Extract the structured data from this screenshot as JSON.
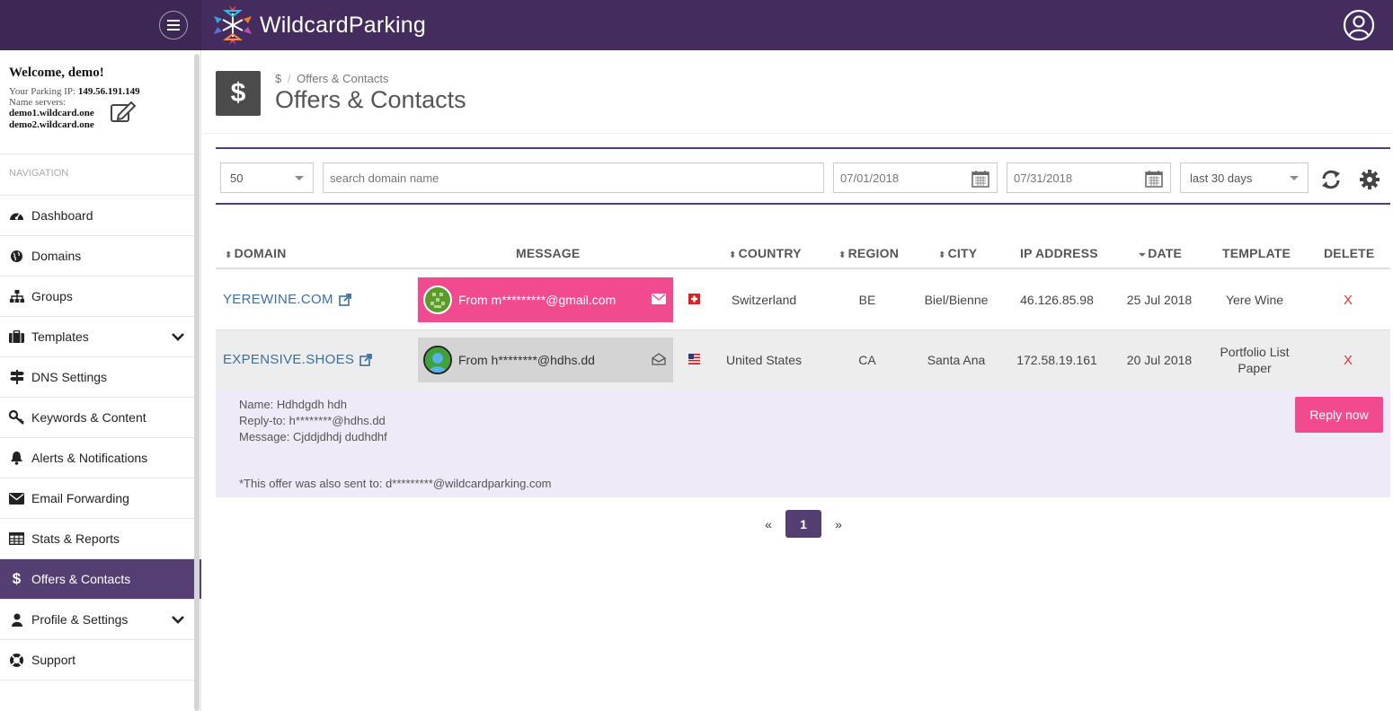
{
  "brand": {
    "name": "WildcardParking"
  },
  "sidebar": {
    "welcome": "Welcome, demo!",
    "parking_ip_label": "Your Parking IP:",
    "parking_ip": "149.56.191.149",
    "nameservers_label": "Name servers:",
    "ns1": "demo1.wildcard.one",
    "ns2": "demo2.wildcard.one",
    "nav_heading": "NAVIGATION",
    "items": [
      {
        "label": "Dashboard",
        "icon": "dashboard-icon"
      },
      {
        "label": "Domains",
        "icon": "globe-icon"
      },
      {
        "label": "Groups",
        "icon": "sitemap-icon"
      },
      {
        "label": "Templates",
        "icon": "briefcase-icon",
        "expandable": true
      },
      {
        "label": "DNS Settings",
        "icon": "signpost-icon"
      },
      {
        "label": "Keywords & Content",
        "icon": "key-icon"
      },
      {
        "label": "Alerts & Notifications",
        "icon": "bell-icon"
      },
      {
        "label": "Email Forwarding",
        "icon": "envelope-icon"
      },
      {
        "label": "Stats & Reports",
        "icon": "table-icon"
      },
      {
        "label": "Offers & Contacts",
        "icon": "dollar-icon",
        "active": true
      },
      {
        "label": "Profile & Settings",
        "icon": "user-icon",
        "expandable": true
      },
      {
        "label": "Support",
        "icon": "lifebuoy-icon"
      }
    ]
  },
  "page": {
    "icon": "$",
    "breadcrumb_icon": "$",
    "breadcrumb": "Offers & Contacts",
    "title": "Offers & Contacts"
  },
  "filters": {
    "per_page": "50",
    "search_placeholder": "search domain name",
    "date_from": "07/01/2018",
    "date_to": "07/31/2018",
    "range": "last 30 days"
  },
  "table": {
    "headers": {
      "domain": "DOMAIN",
      "message": "MESSAGE",
      "country": "COUNTRY",
      "region": "REGION",
      "city": "CITY",
      "ip": "IP ADDRESS",
      "date": "DATE",
      "template": "TEMPLATE",
      "delete": "DELETE"
    },
    "rows": [
      {
        "domain": "YEREWINE.COM",
        "message": "From m*********@gmail.com",
        "flag": "CH",
        "country": "Switzerland",
        "region": "BE",
        "city": "Biel/Bienne",
        "ip": "46.126.85.98",
        "date": "25 Jul 2018",
        "template": "Yere Wine",
        "delete": "X"
      },
      {
        "domain": "EXPENSIVE.SHOES",
        "message": "From h********@hdhs.dd",
        "flag": "US",
        "country": "United States",
        "region": "CA",
        "city": "Santa Ana",
        "ip": "172.58.19.161",
        "date": "20 Jul 2018",
        "template_line1": "Portfolio List",
        "template_line2": "Paper",
        "delete": "X"
      }
    ]
  },
  "detail": {
    "name": "Name: Hdhdgdh hdh",
    "reply_to": "Reply-to: h********@hdhs.dd",
    "message": "Message: Cjddjdhdj dudhdhf",
    "also_sent": "*This offer was also sent to: d*********@wildcardparking.com",
    "reply_button": "Reply now"
  },
  "pagination": {
    "prev": "«",
    "current": "1",
    "next": "»"
  },
  "colors": {
    "topbar": "#442d5e",
    "accent": "#553f72",
    "pink": "#f24a8e",
    "link": "#3a6fa3",
    "delete": "#e5322d"
  }
}
